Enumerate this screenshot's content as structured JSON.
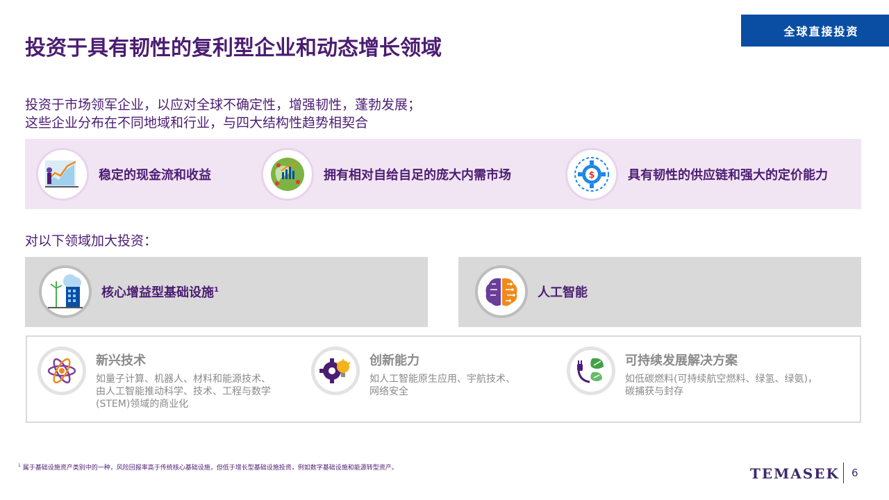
{
  "slide": {
    "title": "投资于具有韧性的复利型企业和动态增长领域",
    "section_tag": "全球直接投资",
    "intro_line1": "投资于市场领军企业，以应对全球不确定性，增强韧性，蓬勃发展；",
    "intro_line2": "这些企业分布在不同地域和行业，与四大结构性趋势相契合",
    "band_items": [
      {
        "label": "稳定的现金流和收益",
        "icon": "growth-chart-icon"
      },
      {
        "label": "拥有相对自给自足的庞大内需市场",
        "icon": "globe-market-icon"
      },
      {
        "label": "具有韧性的供应链和强大的定价能力",
        "icon": "gear-dollar-icon"
      }
    ],
    "subhead": "对以下领域加大投资：",
    "focus_areas": [
      {
        "label": "核心增益型基础设施",
        "sup": "1",
        "icon": "infrastructure-icon"
      },
      {
        "label": "人工智能",
        "sup": "",
        "icon": "ai-brain-icon"
      }
    ],
    "tech_items": [
      {
        "title": "新兴技术",
        "desc": [
          "如量子计算、机器人、材料和能源技术、",
          "由人工智能推动科学、技术、工程与数学",
          "(STEM)领域的商业化"
        ],
        "icon": "atom-icon"
      },
      {
        "title": "创新能力",
        "desc": [
          "如人工智能原生应用、宇航技术、",
          "网络安全"
        ],
        "icon": "gear-bulb-icon"
      },
      {
        "title": "可持续发展解决方案",
        "desc": [
          "如低碳燃料(可持续航空燃料、绿氢、绿氨)，",
          "碳捕获与封存"
        ],
        "icon": "leaf-plug-icon"
      }
    ],
    "footnote_mark": "1",
    "footnote": "属于基础设施资产类别中的一种，风险回报率高于传统核心基础设施，但低于增长型基础设施投资，例如数字基础设施和能源转型资产。",
    "logo": "TEMASEK",
    "page_number": "6",
    "colors": {
      "title_purple": "#4b1d72",
      "tag_blue": "#0a4ea4",
      "band_pink": "#f1e4f3",
      "grey_box": "#d9d9d9"
    }
  }
}
